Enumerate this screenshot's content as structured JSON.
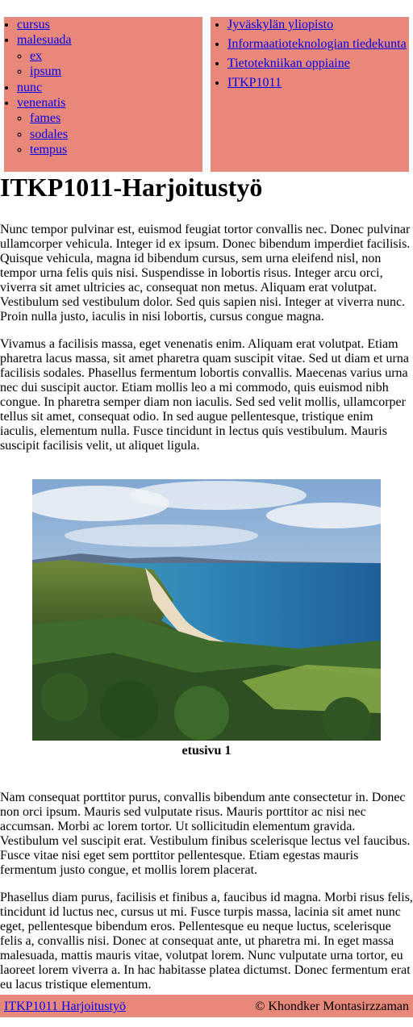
{
  "nav": {
    "menu": [
      {
        "label": "cursus",
        "children": []
      },
      {
        "label": "malesuada",
        "children": [
          {
            "label": "ex"
          },
          {
            "label": "ipsum"
          }
        ]
      },
      {
        "label": "nunc",
        "children": []
      },
      {
        "label": "venenatis",
        "children": [
          {
            "label": "fames"
          },
          {
            "label": "sodales"
          },
          {
            "label": "tempus"
          }
        ]
      }
    ],
    "breadcrumbs": [
      {
        "label": "Jyväskylän yliopisto"
      },
      {
        "label": "Informaatioteknologian tiedekunta"
      },
      {
        "label": "Tietotekniikan oppiaine"
      },
      {
        "label": "ITKP1011"
      }
    ]
  },
  "page": {
    "title": "ITKP1011-Harjoitustyö",
    "paragraphs": [
      "Nunc tempor pulvinar est, euismod feugiat tortor convallis nec. Donec pulvinar ullamcorper vehicula. Integer id ex ipsum. Donec bibendum imperdiet facilisis. Quisque vehicula, magna id bibendum cursus, sem urna eleifend nisl, non tempor urna felis quis nisi. Suspendisse in lobortis risus. Integer arcu orci, viverra sit amet ultricies ac, consequat non metus. Aliquam erat volutpat. Vestibulum sed vestibulum dolor. Sed quis sapien nisi. Integer at viverra nunc. Proin nulla justo, iaculis in nisi lobortis, cursus congue magna.",
      "Vivamus a facilisis massa, eget venenatis enim. Aliquam erat volutpat. Etiam pharetra lacus massa, sit amet pharetra quam suscipit vitae. Sed ut diam et urna facilisis sodales. Phasellus fermentum lobortis convallis. Maecenas varius urna nec dui suscipit auctor. Etiam mollis leo a mi commodo, quis euismod nibh congue. In pharetra semper diam non iaculis. Sed sed velit mollis, ullamcorper tellus sit amet, consequat odio. In sed augue pellentesque, tristique enim iaculis, elementum nulla. Fusce tincidunt in lectus quis vestibulum. Mauris suscipit facilisis velit, ut aliquet ligula.",
      "Nam consequat porttitor purus, convallis bibendum ante consectetur in. Donec non orci ipsum. Mauris sed vulputate risus. Mauris porttitor ac nisi nec accumsan. Morbi ac lorem tortor. Ut sollicitudin elementum gravida. Vestibulum vel suscipit erat. Vestibulum finibus scelerisque lectus vel faucibus. Fusce vitae nisi eget sem porttitor pellentesque. Etiam egestas mauris fermentum justo congue, et mollis lorem placerat.",
      "Phasellus diam purus, facilisis et finibus a, faucibus id magna. Morbi risus felis, tincidunt id luctus nec, cursus ut mi. Fusce turpis massa, lacinia sit amet nunc eget, pellentesque bibendum eros. Pellentesque eu neque luctus, scelerisque felis a, convallis nisi. Donec at consequat ante, ut pharetra mi. In eget massa malesuada, mattis mauris vitae, volutpat lorem. Nunc vulputate urna tortor, eu laoreet lorem viverra a. In hac habitasse platea dictumst. Donec fermentum erat eu lacus tristique elementum."
    ],
    "figure_caption": "etusivu 1"
  },
  "footer": {
    "link": "ITKP1011 Harjoitustyö",
    "copyright": "©  Khondker Montasirzzaman"
  },
  "colors": {
    "panel": "#e8887a",
    "link": "#0000ee"
  }
}
